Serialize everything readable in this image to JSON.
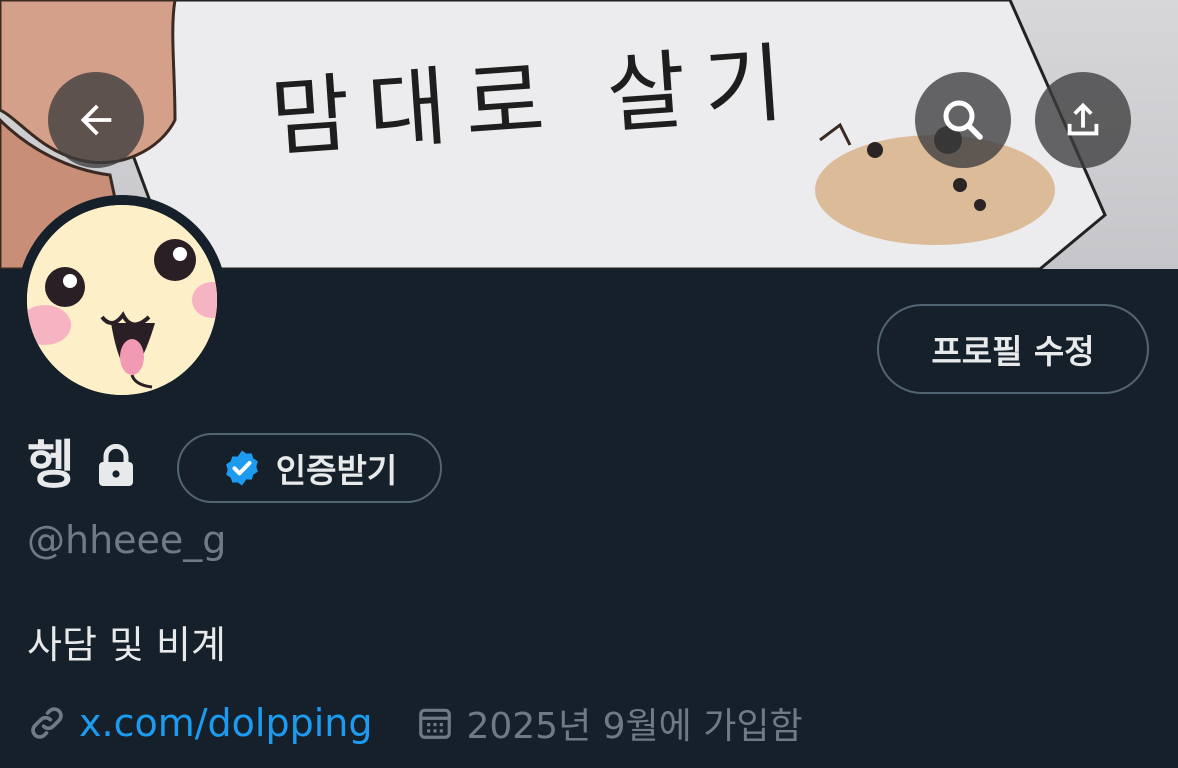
{
  "banner": {
    "handwritten_text": "맘대로 살기"
  },
  "nav": {
    "back_icon": "arrow-left-icon",
    "search_icon": "search-icon",
    "share_icon": "share-upload-icon"
  },
  "profile": {
    "display_name": "헹",
    "handle": "@hheee_g",
    "bio": "사담 및 비계",
    "edit_profile_label": "프로필 수정",
    "verify_label": "인증받기",
    "link": "x.com/dolpping",
    "joined": "2025년 9월에 가입함",
    "lock_icon": "lock-icon"
  },
  "colors": {
    "background": "#15202b",
    "accent": "#1d9bf0",
    "border": "#536471",
    "secondary_text": "#6e7b87"
  }
}
